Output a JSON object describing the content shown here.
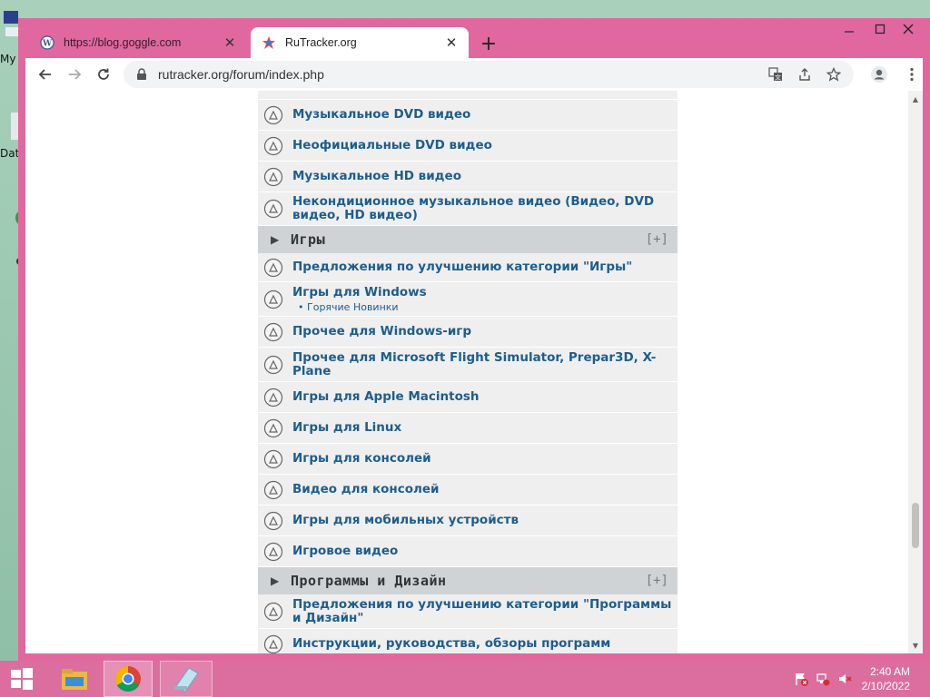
{
  "browser": {
    "tabs": [
      {
        "title": "https://blog.goggle.com",
        "icon": "wordpress-icon",
        "active": false
      },
      {
        "title": "RuTracker.org",
        "icon": "rutracker-icon",
        "active": true
      }
    ],
    "url": "rutracker.org/forum/index.php"
  },
  "desktop": {
    "labels": [
      "My",
      "Dat"
    ]
  },
  "forum": {
    "rows_top": [
      {
        "title": "Музыкальное DVD видео"
      },
      {
        "title": "Неофициальные DVD видео"
      },
      {
        "title": "Музыкальное HD видео"
      },
      {
        "title": "Некондиционное музыкальное видео (Видео, DVD видео, HD видео)"
      }
    ],
    "category_games": {
      "title": "Игры",
      "toggle": "[+]"
    },
    "rows_games": [
      {
        "title": "Предложения по улучшению категории \"Игры\""
      },
      {
        "title": "Игры для Windows",
        "sub": "Горячие Новинки"
      },
      {
        "title": "Прочее для Windows-игр"
      },
      {
        "title": "Прочее для Microsoft Flight Simulator, Prepar3D, X-Plane"
      },
      {
        "title": "Игры для Apple Macintosh"
      },
      {
        "title": "Игры для Linux"
      },
      {
        "title": "Игры для консолей"
      },
      {
        "title": "Видео для консолей"
      },
      {
        "title": "Игры для мобильных устройств"
      },
      {
        "title": "Игровое видео"
      }
    ],
    "category_software": {
      "title": "Программы и Дизайн",
      "toggle": "[+]"
    },
    "rows_software": [
      {
        "title": "Предложения по улучшению категории \"Программы и Дизайн\""
      },
      {
        "title": "Инструкции, руководства, обзоры программ"
      }
    ]
  },
  "taskbar": {
    "time": "2:40 AM",
    "date": "2/10/2022"
  },
  "colors": {
    "window_frame": "#e0689f",
    "taskbar": "#dc6d9f",
    "link": "#1e5d8c",
    "category_bg": "#cfd3d6",
    "row_bg": "#efefef"
  }
}
